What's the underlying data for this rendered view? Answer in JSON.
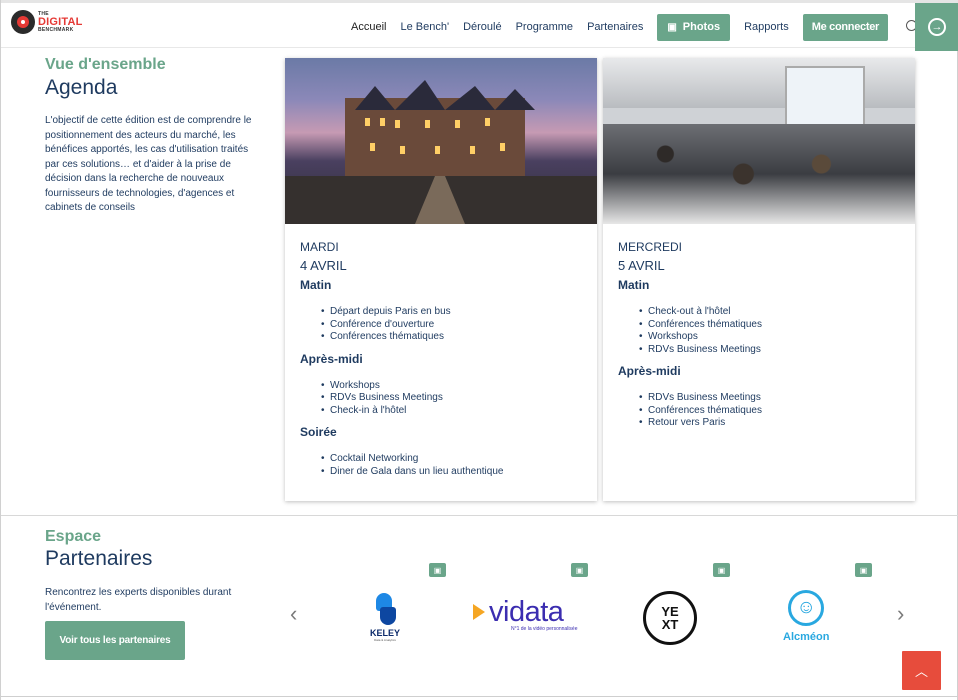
{
  "header": {
    "logo": {
      "line1": "THE",
      "line2": "DIGITAL",
      "line3": "BENCHMARK"
    },
    "nav": [
      "Accueil",
      "Le Bench'",
      "Déroulé",
      "Programme",
      "Partenaires"
    ],
    "photos_label": "Photos",
    "reports_label": "Rapports",
    "login_label": "Me connecter",
    "icons": {
      "photos": "image-icon",
      "search": "search-icon",
      "login": "sign-in-icon"
    }
  },
  "agenda": {
    "subtitle": "Vue d'ensemble",
    "title": "Agenda",
    "description": "L'objectif de cette édition est de comprendre le positionnement des acteurs du marché, les bénéfices apportés, les cas d'utilisation traités par ces solutions… et d'aider à la prise de décision dans la recherche de nouveaux fournisseurs de technologies, d'agences et cabinets de conseils",
    "days": [
      {
        "day": "MARDI",
        "date": "4 AVRIL",
        "sections": [
          {
            "title": "Matin",
            "items": [
              "Départ depuis Paris en bus",
              "Conférence d'ouverture",
              "Conférences thématiques"
            ]
          },
          {
            "title": "Après-midi",
            "items": [
              "Workshops",
              "RDVs Business Meetings",
              "Check-in à l'hôtel"
            ]
          },
          {
            "title": "Soirée",
            "items": [
              "Cocktail Networking",
              "Diner de Gala dans un lieu authentique"
            ]
          }
        ]
      },
      {
        "day": "MERCREDI",
        "date": "5 AVRIL",
        "sections": [
          {
            "title": "Matin",
            "items": [
              "Check-out à l'hôtel",
              "Conférences thématiques",
              "Workshops",
              "RDVs Business Meetings"
            ]
          },
          {
            "title": "Après-midi",
            "items": [
              "RDVs Business Meetings",
              "Conférences thématiques",
              "Retour vers Paris"
            ]
          }
        ]
      }
    ]
  },
  "partners": {
    "subtitle": "Espace",
    "title": "Partenaires",
    "description": "Rencontrez les experts disponibles durant l'événement.",
    "button_label": "Voir tous les partenaires",
    "logos": [
      {
        "name": "KELEY",
        "tagline": "Data & Analytics"
      },
      {
        "name": "vidata",
        "tagline": "N°1 de la vidéo personnalisée"
      },
      {
        "name_line1": "YE",
        "name_line2": "XT"
      },
      {
        "name": "Alcméon"
      }
    ],
    "prev_icon": "chevron-left-icon",
    "next_icon": "chevron-right-icon"
  },
  "back_to_top_icon": "chevron-up-icon",
  "colors": {
    "accent": "#6aa58a",
    "text": "#1e3a5f",
    "back_to_top": "#e74c3c"
  }
}
